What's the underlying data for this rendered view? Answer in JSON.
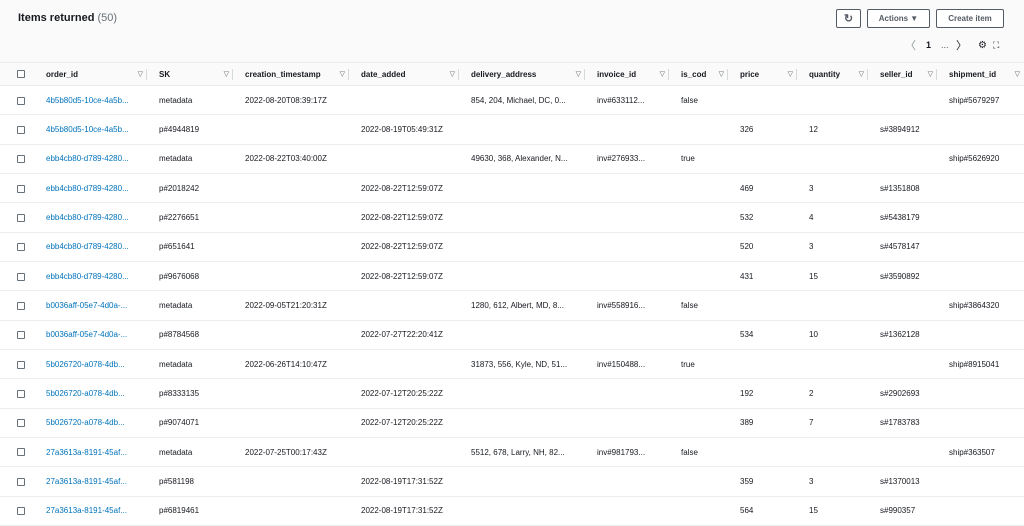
{
  "header": {
    "title": "Items returned",
    "count": "(50)",
    "refresh_icon": "refresh-icon",
    "actions_label": "Actions ▼",
    "create_label": "Create item"
  },
  "pagination": {
    "prev": "〈",
    "page": "1",
    "ellipsis": "...",
    "next": "〉",
    "settings_icon": "gear-icon",
    "expand_icon": "expand-icon"
  },
  "table": {
    "columns": [
      "order_id",
      "SK",
      "creation_timestamp",
      "date_added",
      "delivery_address",
      "invoice_id",
      "is_cod",
      "price",
      "quantity",
      "seller_id",
      "shipment_id"
    ],
    "rows": [
      [
        "4b5b80d5-10ce-4a5b...",
        "metadata",
        "2022-08-20T08:39:17Z",
        "",
        "854, 204, Michael, DC, 0...",
        "inv#633112...",
        "false",
        "",
        "",
        "",
        "ship#5679297"
      ],
      [
        "4b5b80d5-10ce-4a5b...",
        "p#4944819",
        "",
        "2022-08-19T05:49:31Z",
        "",
        "",
        "",
        "326",
        "12",
        "s#3894912",
        ""
      ],
      [
        "ebb4cb80-d789-4280...",
        "metadata",
        "2022-08-22T03:40:00Z",
        "",
        "49630, 368, Alexander, N...",
        "inv#276933...",
        "true",
        "",
        "",
        "",
        "ship#5626920"
      ],
      [
        "ebb4cb80-d789-4280...",
        "p#2018242",
        "",
        "2022-08-22T12:59:07Z",
        "",
        "",
        "",
        "469",
        "3",
        "s#1351808",
        ""
      ],
      [
        "ebb4cb80-d789-4280...",
        "p#2276651",
        "",
        "2022-08-22T12:59:07Z",
        "",
        "",
        "",
        "532",
        "4",
        "s#5438179",
        ""
      ],
      [
        "ebb4cb80-d789-4280...",
        "p#651641",
        "",
        "2022-08-22T12:59:07Z",
        "",
        "",
        "",
        "520",
        "3",
        "s#4578147",
        ""
      ],
      [
        "ebb4cb80-d789-4280...",
        "p#9676068",
        "",
        "2022-08-22T12:59:07Z",
        "",
        "",
        "",
        "431",
        "15",
        "s#3590892",
        ""
      ],
      [
        "b0036aff-05e7-4d0a-...",
        "metadata",
        "2022-09-05T21:20:31Z",
        "",
        "1280, 612, Albert, MD, 8...",
        "inv#558916...",
        "false",
        "",
        "",
        "",
        "ship#3864320"
      ],
      [
        "b0036aff-05e7-4d0a-...",
        "p#8784568",
        "",
        "2022-07-27T22:20:41Z",
        "",
        "",
        "",
        "534",
        "10",
        "s#1362128",
        ""
      ],
      [
        "5b026720-a078-4db...",
        "metadata",
        "2022-06-26T14:10:47Z",
        "",
        "31873, 556, Kyle, ND, 51...",
        "inv#150488...",
        "true",
        "",
        "",
        "",
        "ship#8915041"
      ],
      [
        "5b026720-a078-4db...",
        "p#8333135",
        "",
        "2022-07-12T20:25:22Z",
        "",
        "",
        "",
        "192",
        "2",
        "s#2902693",
        ""
      ],
      [
        "5b026720-a078-4db...",
        "p#9074071",
        "",
        "2022-07-12T20:25:22Z",
        "",
        "",
        "",
        "389",
        "7",
        "s#1783783",
        ""
      ],
      [
        "27a3613a-8191-45af...",
        "metadata",
        "2022-07-25T00:17:43Z",
        "",
        "5512, 678, Larry, NH, 82...",
        "inv#981793...",
        "false",
        "",
        "",
        "",
        "ship#363507"
      ],
      [
        "27a3613a-8191-45af...",
        "p#581198",
        "",
        "2022-08-19T17:31:52Z",
        "",
        "",
        "",
        "359",
        "3",
        "s#1370013",
        ""
      ],
      [
        "27a3613a-8191-45af...",
        "p#6819461",
        "",
        "2022-08-19T17:31:52Z",
        "",
        "",
        "",
        "564",
        "15",
        "s#990357",
        ""
      ]
    ]
  },
  "colors": {
    "link": "#0073bb",
    "header_bg": "#fafafa",
    "border": "#eaeded"
  }
}
